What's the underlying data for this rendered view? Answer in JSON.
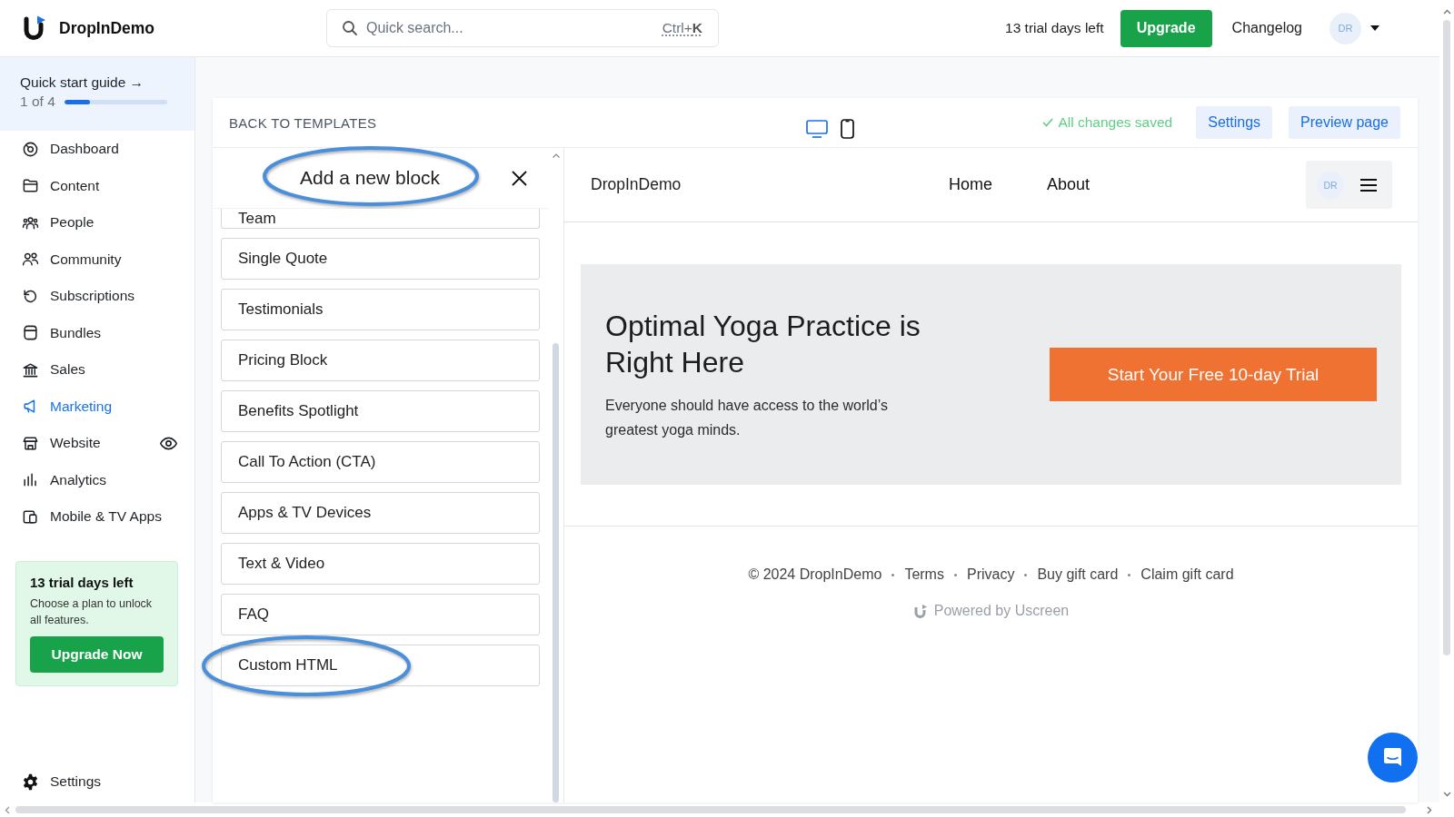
{
  "top_bar": {
    "brand": "DropInDemo",
    "search": {
      "placeholder": "Quick search...",
      "shortcut": "Ctrl+**K**"
    },
    "trial_notice": "13 trial days left",
    "upgrade_button": "Upgrade",
    "changelog_link": "Changelog",
    "avatar_initials": "DR"
  },
  "sidebar": {
    "quick_start": {
      "title": "Quick start guide →",
      "progress_text": "1 of 4",
      "level": 0.25
    },
    "items": [
      {
        "label": "Dashboard",
        "selected": false
      },
      {
        "label": "Content",
        "selected": false
      },
      {
        "label": "People",
        "selected": false
      },
      {
        "label": "Community",
        "selected": false
      },
      {
        "label": "Subscriptions",
        "selected": false
      },
      {
        "label": "Bundles",
        "selected": false
      },
      {
        "label": "Sales",
        "selected": false
      },
      {
        "label": "Marketing",
        "selected": true
      },
      {
        "label": "Website",
        "selected": false
      },
      {
        "label": "Analytics",
        "selected": false
      },
      {
        "label": "Mobile & TV Apps",
        "selected": false
      }
    ],
    "trial_card": {
      "title": "13 trial days left",
      "text": "Choose a plan to unlock all features.",
      "button": "Upgrade Now"
    },
    "settings": "Settings"
  },
  "editor": {
    "back_link": "BACK TO TEMPLATES",
    "view_modes": [
      {
        "selected": true
      },
      {
        "selected": false
      }
    ],
    "save_status": "All changes saved",
    "buttons": [
      "Settings",
      "Preview page"
    ],
    "panel": {
      "title": "Add a new block",
      "title_highlighted": true,
      "blocks": [
        {
          "label": "Team",
          "highlighted": false
        },
        {
          "label": "Single Quote",
          "highlighted": false
        },
        {
          "label": "Testimonials",
          "highlighted": false
        },
        {
          "label": "Pricing Block",
          "highlighted": false
        },
        {
          "label": "Benefits Spotlight",
          "highlighted": false
        },
        {
          "label": "Call To Action (CTA)",
          "highlighted": false
        },
        {
          "label": "Apps & TV Devices",
          "highlighted": false
        },
        {
          "label": "Text & Video",
          "highlighted": false
        },
        {
          "label": "FAQ",
          "highlighted": false
        },
        {
          "label": "Custom HTML",
          "highlighted": true
        }
      ]
    },
    "preview": {
      "brand": "DropInDemo",
      "nav": [
        "Home",
        "About"
      ],
      "avatar_initials": "DR",
      "hero": {
        "title": "Optimal Yoga Practice is Right Here",
        "text": "Everyone should have access to the world’s greatest yoga minds.",
        "cta": "Start Your Free 10-day Trial"
      },
      "footer": {
        "copyright": "© 2024 DropInDemo",
        "links": [
          "Terms",
          "Privacy",
          "Buy gift card",
          "Claim gift card"
        ],
        "powered_by": "Powered by Uscreen"
      }
    }
  }
}
